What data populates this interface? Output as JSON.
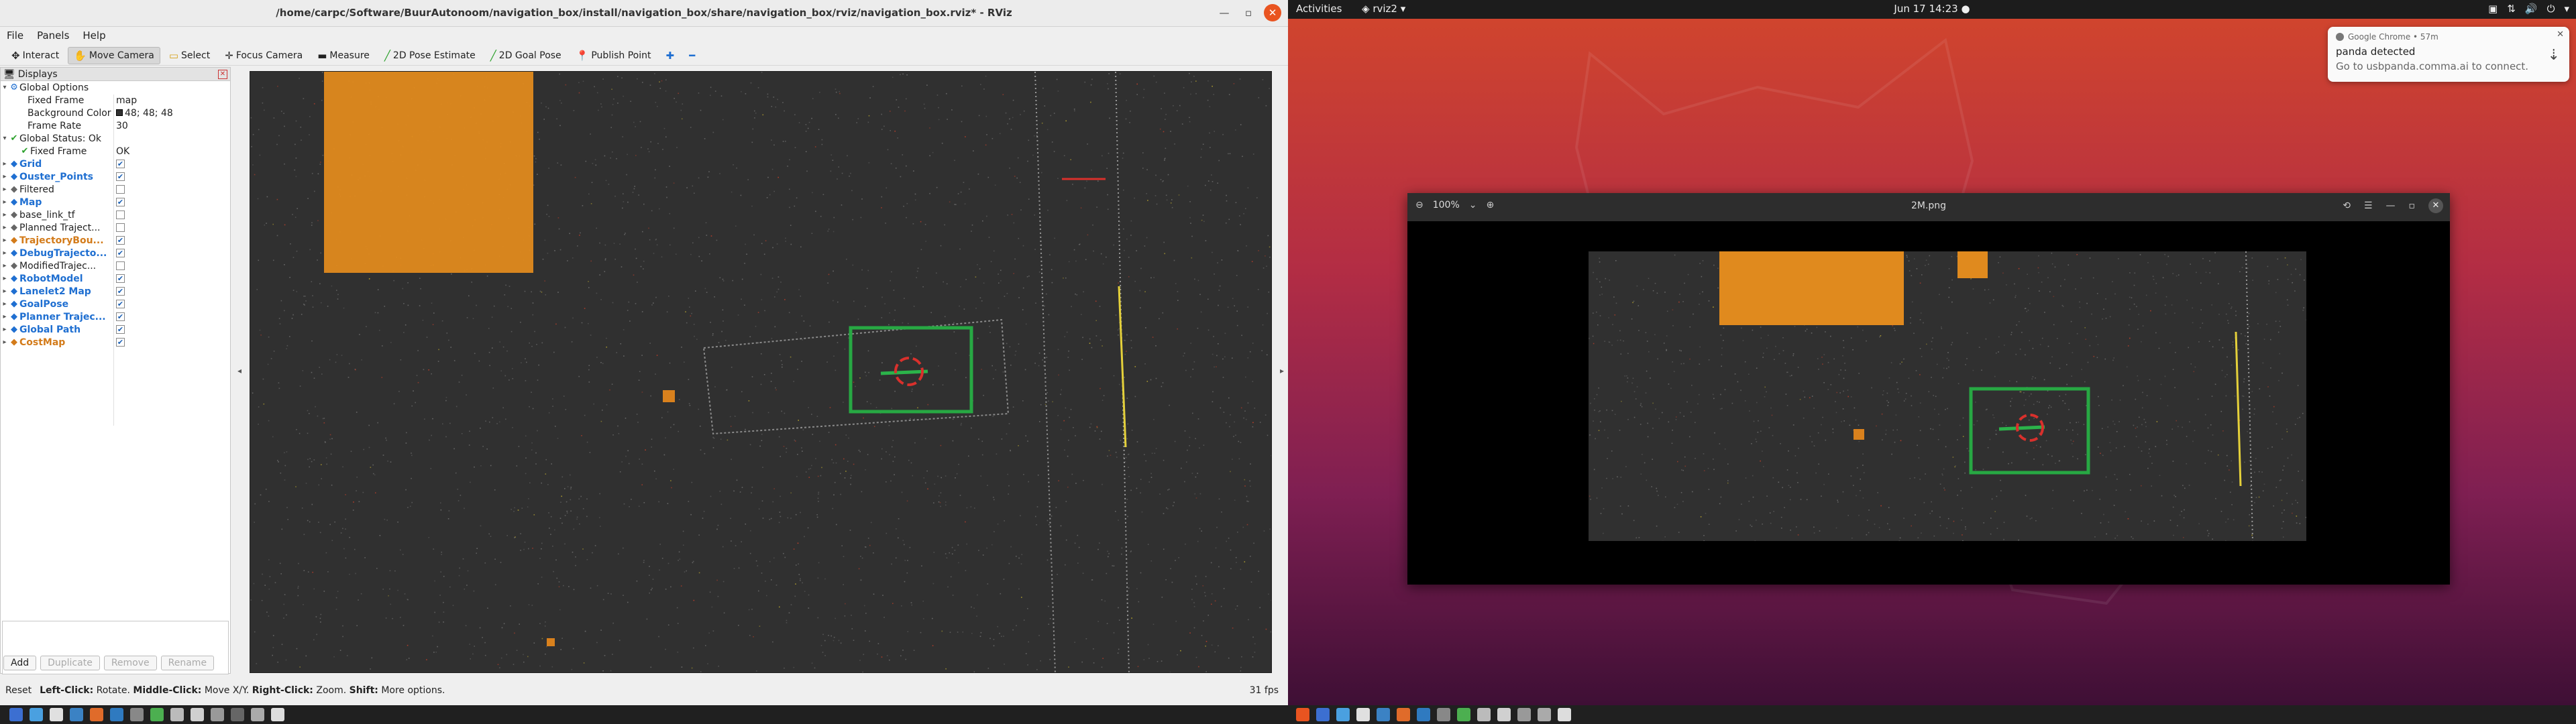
{
  "rviz": {
    "window_title": "/home/carpc/Software/BuurAutonoom/navigation_box/install/navigation_box/share/navigation_box/rviz/navigation_box.rviz* - RViz",
    "menu": [
      "File",
      "Panels",
      "Help"
    ],
    "toolbar": [
      {
        "label": "Interact",
        "icon": "interact-icon"
      },
      {
        "label": "Move Camera",
        "icon": "move-camera-icon"
      },
      {
        "label": "Select",
        "icon": "select-icon"
      },
      {
        "label": "Focus Camera",
        "icon": "focus-camera-icon"
      },
      {
        "label": "Measure",
        "icon": "measure-icon"
      },
      {
        "label": "2D Pose Estimate",
        "icon": "pose-estimate-icon"
      },
      {
        "label": "2D Goal Pose",
        "icon": "goal-pose-icon"
      },
      {
        "label": "Publish Point",
        "icon": "publish-point-icon"
      }
    ],
    "displays_title": "Displays",
    "global_options": {
      "label": "Global Options",
      "fixed_frame_label": "Fixed Frame",
      "fixed_frame_value": "map",
      "bg_label": "Background Color",
      "bg_value": "48; 48; 48",
      "frame_rate_label": "Frame Rate",
      "frame_rate_value": "30"
    },
    "global_status": {
      "label": "Global Status: Ok",
      "child_label": "Fixed Frame",
      "child_value": "OK"
    },
    "displays": [
      {
        "name": "Grid",
        "style": "blue",
        "checked": true
      },
      {
        "name": "Ouster_Points",
        "style": "blue",
        "checked": true
      },
      {
        "name": "Filtered",
        "style": "plain",
        "checked": false
      },
      {
        "name": "Map",
        "style": "blue",
        "checked": true
      },
      {
        "name": "base_link_tf",
        "style": "plain",
        "checked": false
      },
      {
        "name": "Planned Traject...",
        "style": "plain",
        "checked": false
      },
      {
        "name": "TrajectoryBou...",
        "style": "orange",
        "checked": true
      },
      {
        "name": "DebugTrajecto...",
        "style": "blue",
        "checked": true
      },
      {
        "name": "ModifiedTrajec...",
        "style": "plain",
        "checked": false
      },
      {
        "name": "RobotModel",
        "style": "blue",
        "checked": true
      },
      {
        "name": "Lanelet2 Map",
        "style": "blue",
        "checked": true
      },
      {
        "name": "GoalPose",
        "style": "blue",
        "checked": true
      },
      {
        "name": "Planner Trajec...",
        "style": "blue",
        "checked": true
      },
      {
        "name": "Global Path",
        "style": "blue",
        "checked": true
      },
      {
        "name": "CostMap",
        "style": "orange",
        "checked": true
      }
    ],
    "buttons": {
      "add": "Add",
      "duplicate": "Duplicate",
      "remove": "Remove",
      "rename": "Rename"
    },
    "status": {
      "reset": "Reset",
      "hint_1b": "Left-Click:",
      "hint_1": "Rotate.",
      "hint_2b": "Middle-Click:",
      "hint_2": "Move X/Y.",
      "hint_3b": "Right-Click:",
      "hint_3": "Zoom.",
      "hint_4b": "Shift:",
      "hint_4": "More options.",
      "fps": "31 fps"
    }
  },
  "desktop": {
    "activities": "Activities",
    "app_menu": "rviz2",
    "clock": "Jun 17  14:23",
    "notification": {
      "source": "Google Chrome • 57m",
      "title": "panda detected",
      "body": "Go to usbpanda.comma.ai to connect."
    },
    "viewer": {
      "zoom": "100%",
      "filename": "2M.png"
    }
  },
  "colors": {
    "viewport_bg": "#303030",
    "accent_orange": "#e95420",
    "costmap_orange": "#e08a1e",
    "goal_green": "#2bb34a"
  }
}
